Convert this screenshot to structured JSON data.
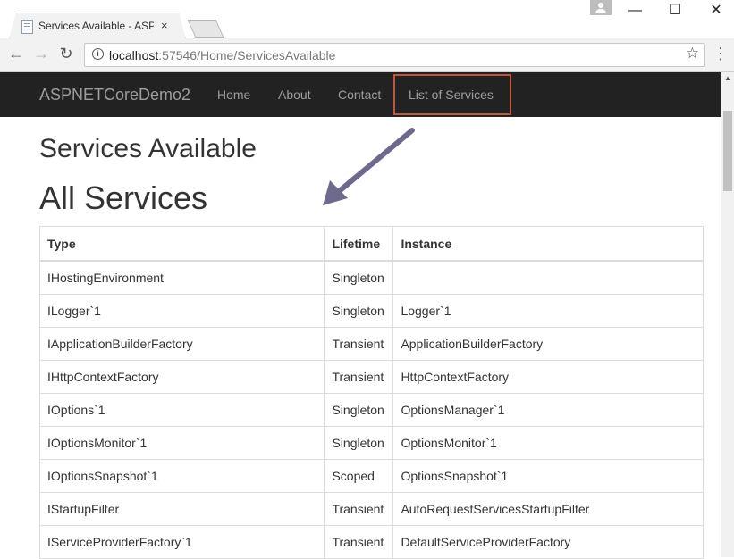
{
  "browser": {
    "tab_title": "Services Available - ASP.NET",
    "tab_close": "×",
    "url_host": "localhost",
    "url_rest": ":57546/Home/ServicesAvailable",
    "window_minimize": "—",
    "window_maximize": "☐",
    "window_close": "✕"
  },
  "navbar": {
    "brand": "ASPNETCoreDemo2",
    "links": [
      "Home",
      "About",
      "Contact",
      "List of Services"
    ],
    "highlight_color": "#c0563a"
  },
  "page": {
    "subtitle": "Services Available",
    "title": "All Services"
  },
  "table": {
    "headers": [
      "Type",
      "Lifetime",
      "Instance"
    ],
    "rows": [
      [
        "IHostingEnvironment",
        "Singleton",
        ""
      ],
      [
        "ILogger`1",
        "Singleton",
        "Logger`1"
      ],
      [
        "IApplicationBuilderFactory",
        "Transient",
        "ApplicationBuilderFactory"
      ],
      [
        "IHttpContextFactory",
        "Transient",
        "HttpContextFactory"
      ],
      [
        "IOptions`1",
        "Singleton",
        "OptionsManager`1"
      ],
      [
        "IOptionsMonitor`1",
        "Singleton",
        "OptionsMonitor`1"
      ],
      [
        "IOptionsSnapshot`1",
        "Scoped",
        "OptionsSnapshot`1"
      ],
      [
        "IStartupFilter",
        "Transient",
        "AutoRequestServicesStartupFilter"
      ],
      [
        "IServiceProviderFactory`1",
        "Transient",
        "DefaultServiceProviderFactory"
      ]
    ]
  },
  "annotation_arrow_color": "#6e6a8e"
}
